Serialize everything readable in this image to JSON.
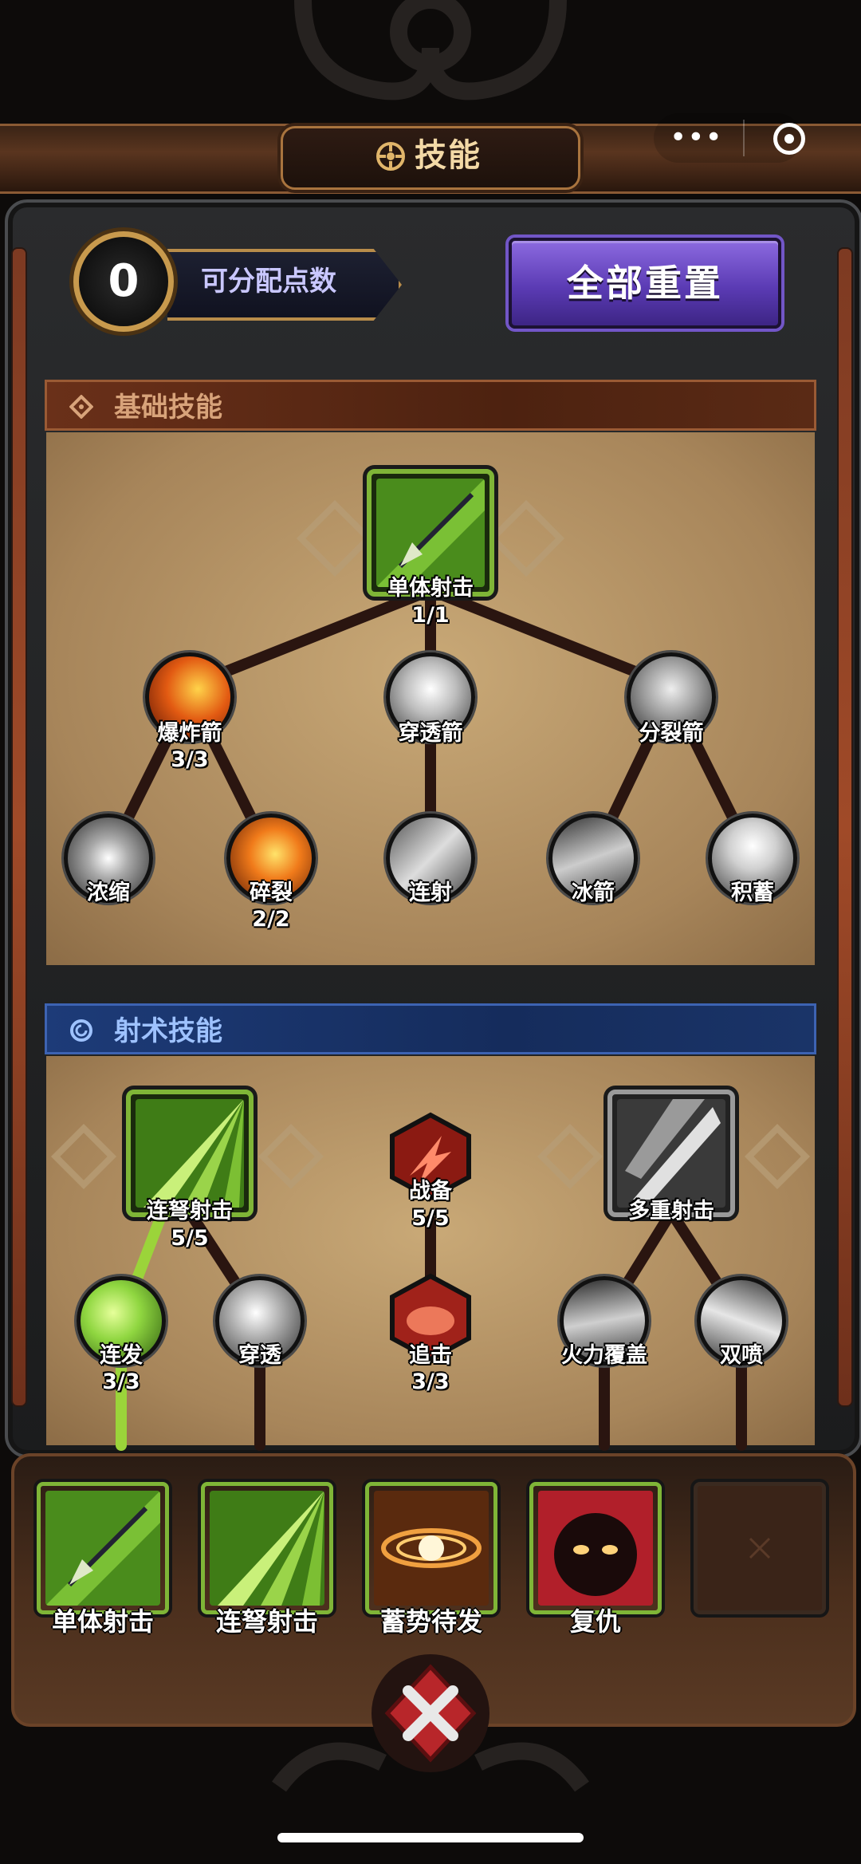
{
  "header": {
    "title": "技能"
  },
  "points": {
    "value": "0",
    "label": "可分配点数"
  },
  "reset_button": {
    "label": "全部重置"
  },
  "basic": {
    "title": "基础技能",
    "root": {
      "name": "单体射击",
      "level": "1/1"
    },
    "mid": [
      {
        "name": "爆炸箭",
        "level": "3/3"
      },
      {
        "name": "穿透箭",
        "level": ""
      },
      {
        "name": "分裂箭",
        "level": ""
      }
    ],
    "leaf": [
      {
        "name": "浓缩",
        "level": ""
      },
      {
        "name": "碎裂",
        "level": "2/2"
      },
      {
        "name": "连射",
        "level": ""
      },
      {
        "name": "冰箭",
        "level": ""
      },
      {
        "name": "积蓄",
        "level": ""
      }
    ]
  },
  "archery": {
    "title": "射术技能",
    "left_root": {
      "name": "连弩射击",
      "level": "5/5"
    },
    "center": {
      "name": "战备",
      "level": "5/5"
    },
    "right_root": {
      "name": "多重射击",
      "level": ""
    },
    "row2": [
      {
        "name": "连发",
        "level": "3/3"
      },
      {
        "name": "穿透",
        "level": ""
      },
      {
        "name": "追击",
        "level": "3/3"
      },
      {
        "name": "火力覆盖",
        "level": ""
      },
      {
        "name": "双喷",
        "level": ""
      }
    ]
  },
  "equipped": [
    {
      "name": "单体射击"
    },
    {
      "name": "连弩射击"
    },
    {
      "name": "蓄势待发"
    },
    {
      "name": "复仇"
    },
    {
      "name": ""
    }
  ],
  "colors": {
    "learned": "#7fb537",
    "basic_header": "#6a3019",
    "archery_header": "#1d3b78",
    "reset": "#5b3bb4"
  }
}
